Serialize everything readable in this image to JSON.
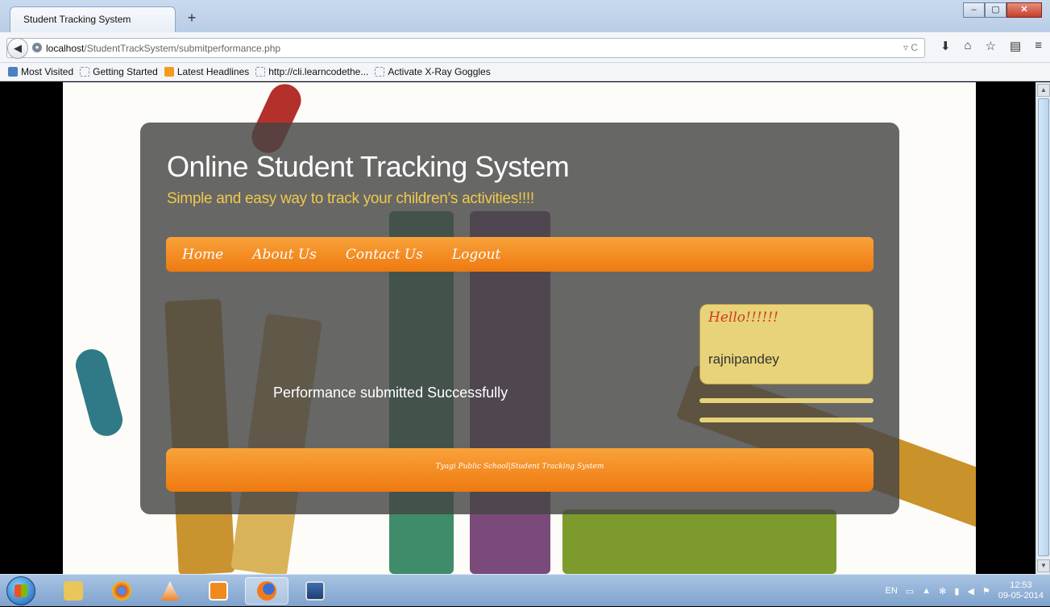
{
  "browser": {
    "tab_title": "Student Tracking System",
    "new_tab": "+",
    "url_host": "localhost",
    "url_path": "/StudentTrackSystem/submitperformance.php",
    "bookmarks": [
      "Most Visited",
      "Getting Started",
      "Latest Headlines",
      "http://cli.learncodethe...",
      "Activate X-Ray Goggles"
    ]
  },
  "site": {
    "title": "Online Student Tracking System",
    "tagline": "Simple and easy way to track your children's activities!!!!",
    "menu": [
      "Home",
      "About Us",
      "Contact Us",
      "Logout"
    ],
    "hello_title": "Hello!!!!!!",
    "username": "rajnipandey",
    "message": "Performance submitted Successfully",
    "footer": "Tyagi Public School|Student Tracking System"
  },
  "taskbar": {
    "language": "EN",
    "time": "12:53",
    "date": "09-05-2014"
  },
  "colors": {
    "accent_orange": "#f28b1c",
    "tagline_yellow": "#f0c94a",
    "hello_red": "#d23c1e",
    "panel_gray": "#464646"
  }
}
